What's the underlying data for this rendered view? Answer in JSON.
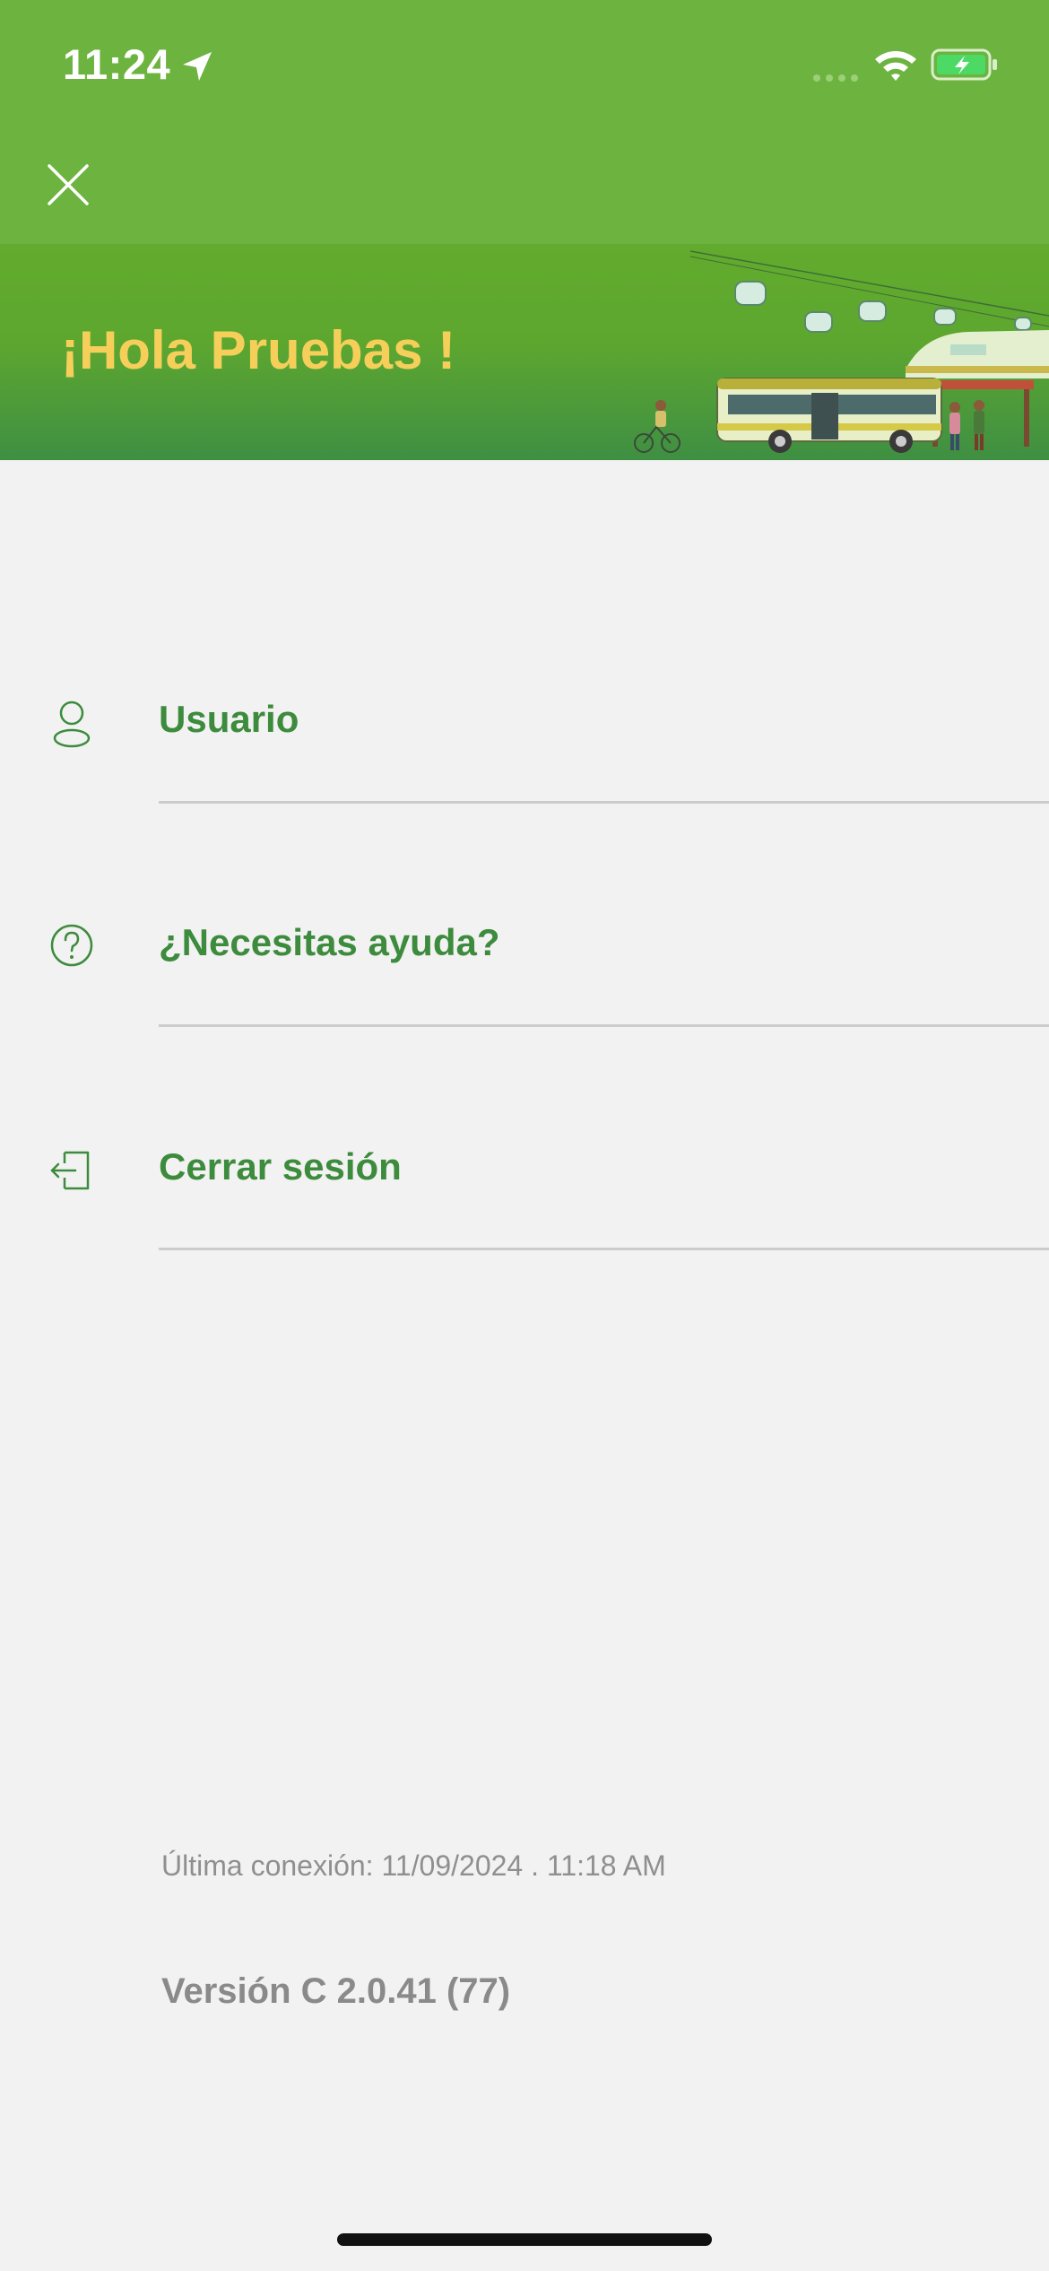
{
  "status_bar": {
    "time": "11:24",
    "icons": [
      "location-arrow-icon",
      "signal-icon",
      "wifi-icon",
      "battery-charging-icon"
    ]
  },
  "header": {
    "close_icon": "close-icon"
  },
  "banner": {
    "greeting": "¡Hola Pruebas !",
    "illustration": "transit-illustration"
  },
  "menu": {
    "items": [
      {
        "label": "Usuario",
        "icon": "user-icon"
      },
      {
        "label": "¿Necesitas ayuda?",
        "icon": "help-icon"
      },
      {
        "label": "Cerrar sesión",
        "icon": "logout-icon"
      }
    ]
  },
  "footer": {
    "last_connection": "Última conexión: 11/09/2024 . 11:18 AM",
    "version": "Versión C 2.0.41 (77)"
  },
  "colors": {
    "primary_green": "#6db33f",
    "label_green": "#3d8b3d",
    "greeting_yellow": "#f5cf5a",
    "background": "#f2f2f2"
  }
}
